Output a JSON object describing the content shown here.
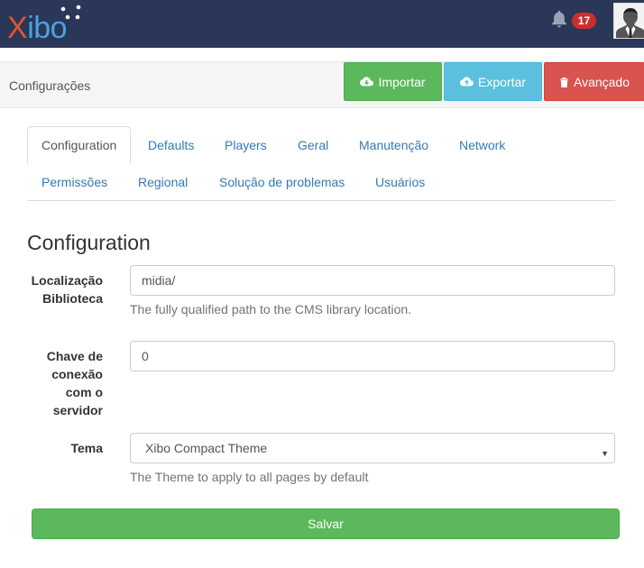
{
  "app": {
    "logo_x": "X",
    "logo_ibo": "ibo",
    "notification_count": "17",
    "colors": {
      "topbar": "#2a3759",
      "logo_x": "#e1562d",
      "logo_ibo": "#4aa3dd",
      "badge": "#c9302c"
    }
  },
  "header": {
    "title": "Configurações",
    "import_label": "Importar",
    "export_label": "Exportar",
    "advanced_label": "Avançado"
  },
  "tabs": [
    {
      "label": "Configuration",
      "active": true
    },
    {
      "label": "Defaults"
    },
    {
      "label": "Players"
    },
    {
      "label": "Geral"
    },
    {
      "label": "Manutenção"
    },
    {
      "label": "Network"
    },
    {
      "label": "Permissões"
    },
    {
      "label": "Regional"
    },
    {
      "label": "Solução de problemas"
    },
    {
      "label": "Usuários"
    }
  ],
  "form": {
    "section_title": "Configuration",
    "library": {
      "label_line1": "Localização",
      "label_line2": "Biblioteca",
      "value": "midia/",
      "help": "The fully qualified path to the CMS library location."
    },
    "server_key": {
      "label_line1": "Chave de",
      "label_line2": "conexão",
      "label_line3": "com o",
      "label_line4": "servidor",
      "value": "0"
    },
    "theme": {
      "label": "Tema",
      "selected": "Xibo Compact Theme",
      "help": "The Theme to apply to all pages by default"
    },
    "save_label": "Salvar"
  }
}
